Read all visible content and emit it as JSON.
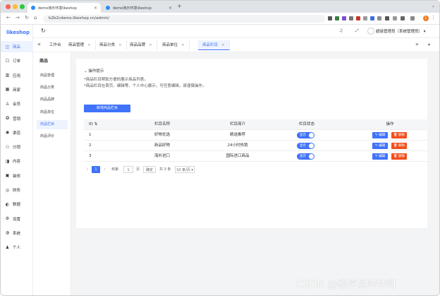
{
  "browser": {
    "tabs": [
      {
        "title": "demo演示环境likeshop"
      },
      {
        "title": "demo演示环境likeshop"
      }
    ],
    "url": "b2b2cdemo.likeshop.cn/admin/",
    "profile_initial": "L"
  },
  "app": {
    "logo": "likeshop",
    "admin_label": "超级管理员（系统管理员）"
  },
  "sidebar": {
    "items": [
      {
        "label": "商品",
        "icon": "bag-icon"
      },
      {
        "label": "订单",
        "icon": "order-icon"
      },
      {
        "label": "应用",
        "icon": "app-icon"
      },
      {
        "label": "商家",
        "icon": "shop-icon"
      },
      {
        "label": "会员",
        "icon": "user-icon"
      },
      {
        "label": "营销",
        "icon": "marketing-icon"
      },
      {
        "label": "渠道",
        "icon": "channel-icon"
      },
      {
        "label": "分销",
        "icon": "distribution-icon"
      },
      {
        "label": "内容",
        "icon": "content-icon"
      },
      {
        "label": "装修",
        "icon": "decoration-icon"
      },
      {
        "label": "财务",
        "icon": "finance-icon"
      },
      {
        "label": "数据",
        "icon": "data-icon"
      },
      {
        "label": "设置",
        "icon": "settings-icon"
      },
      {
        "label": "系统",
        "icon": "system-icon"
      },
      {
        "label": "个人",
        "icon": "person-icon"
      }
    ]
  },
  "subsidebar": {
    "title": "商品",
    "items": [
      "商品管理",
      "商品分类",
      "商品品牌",
      "商品单位",
      "商品栏目",
      "商品评价"
    ]
  },
  "pagetabs": {
    "home": "工作台",
    "items": [
      "商品管理",
      "商品分类",
      "商品品牌",
      "商品单位",
      "商品栏目"
    ]
  },
  "main": {
    "ops_title": "操作提示",
    "tips": [
      "*商品栏目帮助方便的展示商品列表。",
      "*商品栏目在首页、编辑等、个人中心展示，可任意编辑，请谨慎操作。"
    ],
    "add_button": "新增商品栏目",
    "table": {
      "headers": [
        "ID",
        "栏目名称",
        "栏目简介",
        "栏目状态",
        "操作"
      ],
      "rows": [
        {
          "id": "1",
          "name": "好物优选",
          "intro": "精选推荐",
          "status": "显示"
        },
        {
          "id": "2",
          "name": "新品好物",
          "intro": "24小时热销",
          "status": "显示"
        },
        {
          "id": "3",
          "name": "海外进口",
          "intro": "国际进口商品",
          "status": "显示"
        }
      ],
      "edit_label": "编辑",
      "delete_label": "删除"
    },
    "pager": {
      "current": "1",
      "goto_label": "到第",
      "page_input": "1",
      "page_suffix": "页",
      "confirm": "确定",
      "total": "共 3 条",
      "page_size": "10 条/页"
    }
  },
  "watermark": "CSDN @程序员阿钟呀"
}
